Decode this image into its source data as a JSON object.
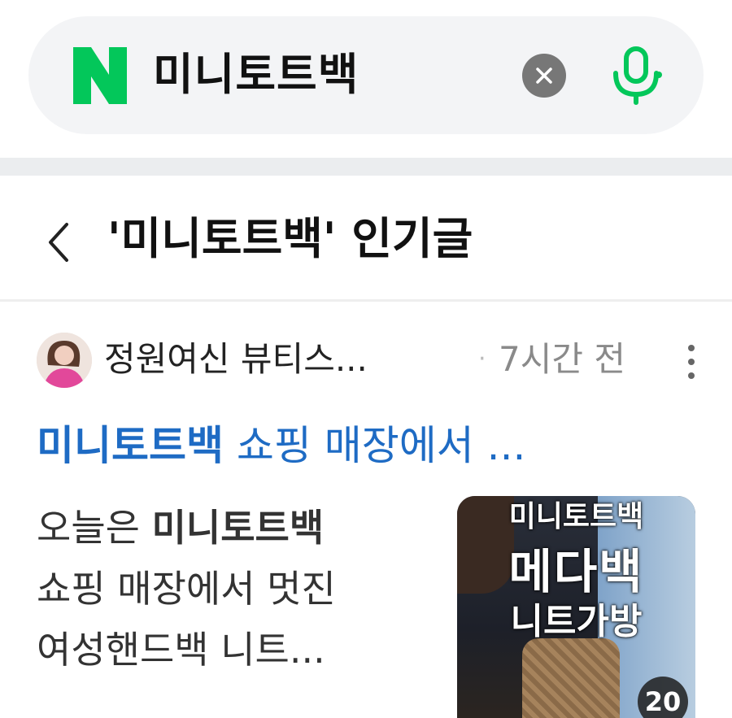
{
  "search": {
    "query": "미니토트백",
    "logo_letter": "N",
    "brand_color": "#03c75a",
    "clear_icon": "close-icon",
    "mic_icon": "microphone-icon"
  },
  "header": {
    "back_icon": "chevron-left-icon",
    "title": "'미니토트백' 인기글"
  },
  "post": {
    "author": "정원여신 뷰티스...",
    "time": "7시간 전",
    "separator": "·",
    "title_keyword": "미니토트백",
    "title_rest": " 쇼핑 매장에서 ...",
    "title_color": "#1e6bc4",
    "body_prefix": "오늘은 ",
    "body_keyword": "미니토트백",
    "body_line2": "쇼핑 매장에서 멋진",
    "body_line3": "여성핸드백 니트...",
    "thumbnail": {
      "text1": "미니토트백",
      "text2": "메다백",
      "text3": "니트가방",
      "image_count": "20"
    }
  }
}
